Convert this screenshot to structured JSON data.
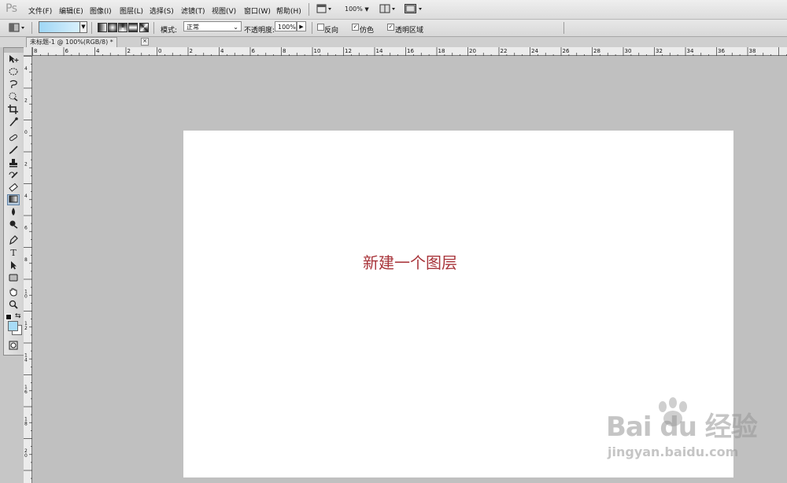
{
  "app": {
    "logo": "Ps"
  },
  "menu": [
    {
      "key": "file",
      "label": "文件(F)"
    },
    {
      "key": "edit",
      "label": "编辑(E)"
    },
    {
      "key": "image",
      "label": "图像(I)"
    },
    {
      "key": "layer",
      "label": "图层(L)"
    },
    {
      "key": "select",
      "label": "选择(S)"
    },
    {
      "key": "filter",
      "label": "滤镜(T)"
    },
    {
      "key": "view",
      "label": "视图(V)"
    },
    {
      "key": "window",
      "label": "窗口(W)"
    },
    {
      "key": "help",
      "label": "帮助(H)"
    }
  ],
  "appbar": {
    "zoom": "100%"
  },
  "options": {
    "mode_label": "模式:",
    "mode_value": "正常",
    "opacity_label": "不透明度:",
    "opacity_value": "100%",
    "reverse_label": "反向",
    "reverse_checked": false,
    "dither_label": "仿色",
    "dither_checked": true,
    "transparency_label": "透明区域",
    "transparency_checked": true,
    "gradient_colors": [
      "#9fd6f5",
      "#d8f0fc"
    ]
  },
  "document": {
    "tab_title": "未标题-1 @ 100%(RGB/8) *",
    "tab_close": "×"
  },
  "rulers": {
    "horizontal_labels": [
      "8",
      "6",
      "4",
      "2",
      "0",
      "2",
      "4",
      "6",
      "8",
      "10",
      "12",
      "14",
      "16",
      "18",
      "20",
      "22",
      "24",
      "26",
      "28",
      "30",
      "32",
      "34",
      "36",
      "38"
    ],
    "vertical_labels": [
      "4",
      "2",
      "0",
      "2",
      "4",
      "6",
      "8",
      "10",
      "12",
      "14",
      "16",
      "18",
      "20"
    ]
  },
  "canvas": {
    "text": "新建一个图层",
    "text_color": "#a8343a",
    "background": "#ffffff"
  },
  "colors": {
    "foreground": "#a8dcf7",
    "background": "#ffffff",
    "workspace": "#c0c0c0"
  },
  "watermark": {
    "logo": "Bai du 经验",
    "url": "jingyan.baidu.com"
  }
}
